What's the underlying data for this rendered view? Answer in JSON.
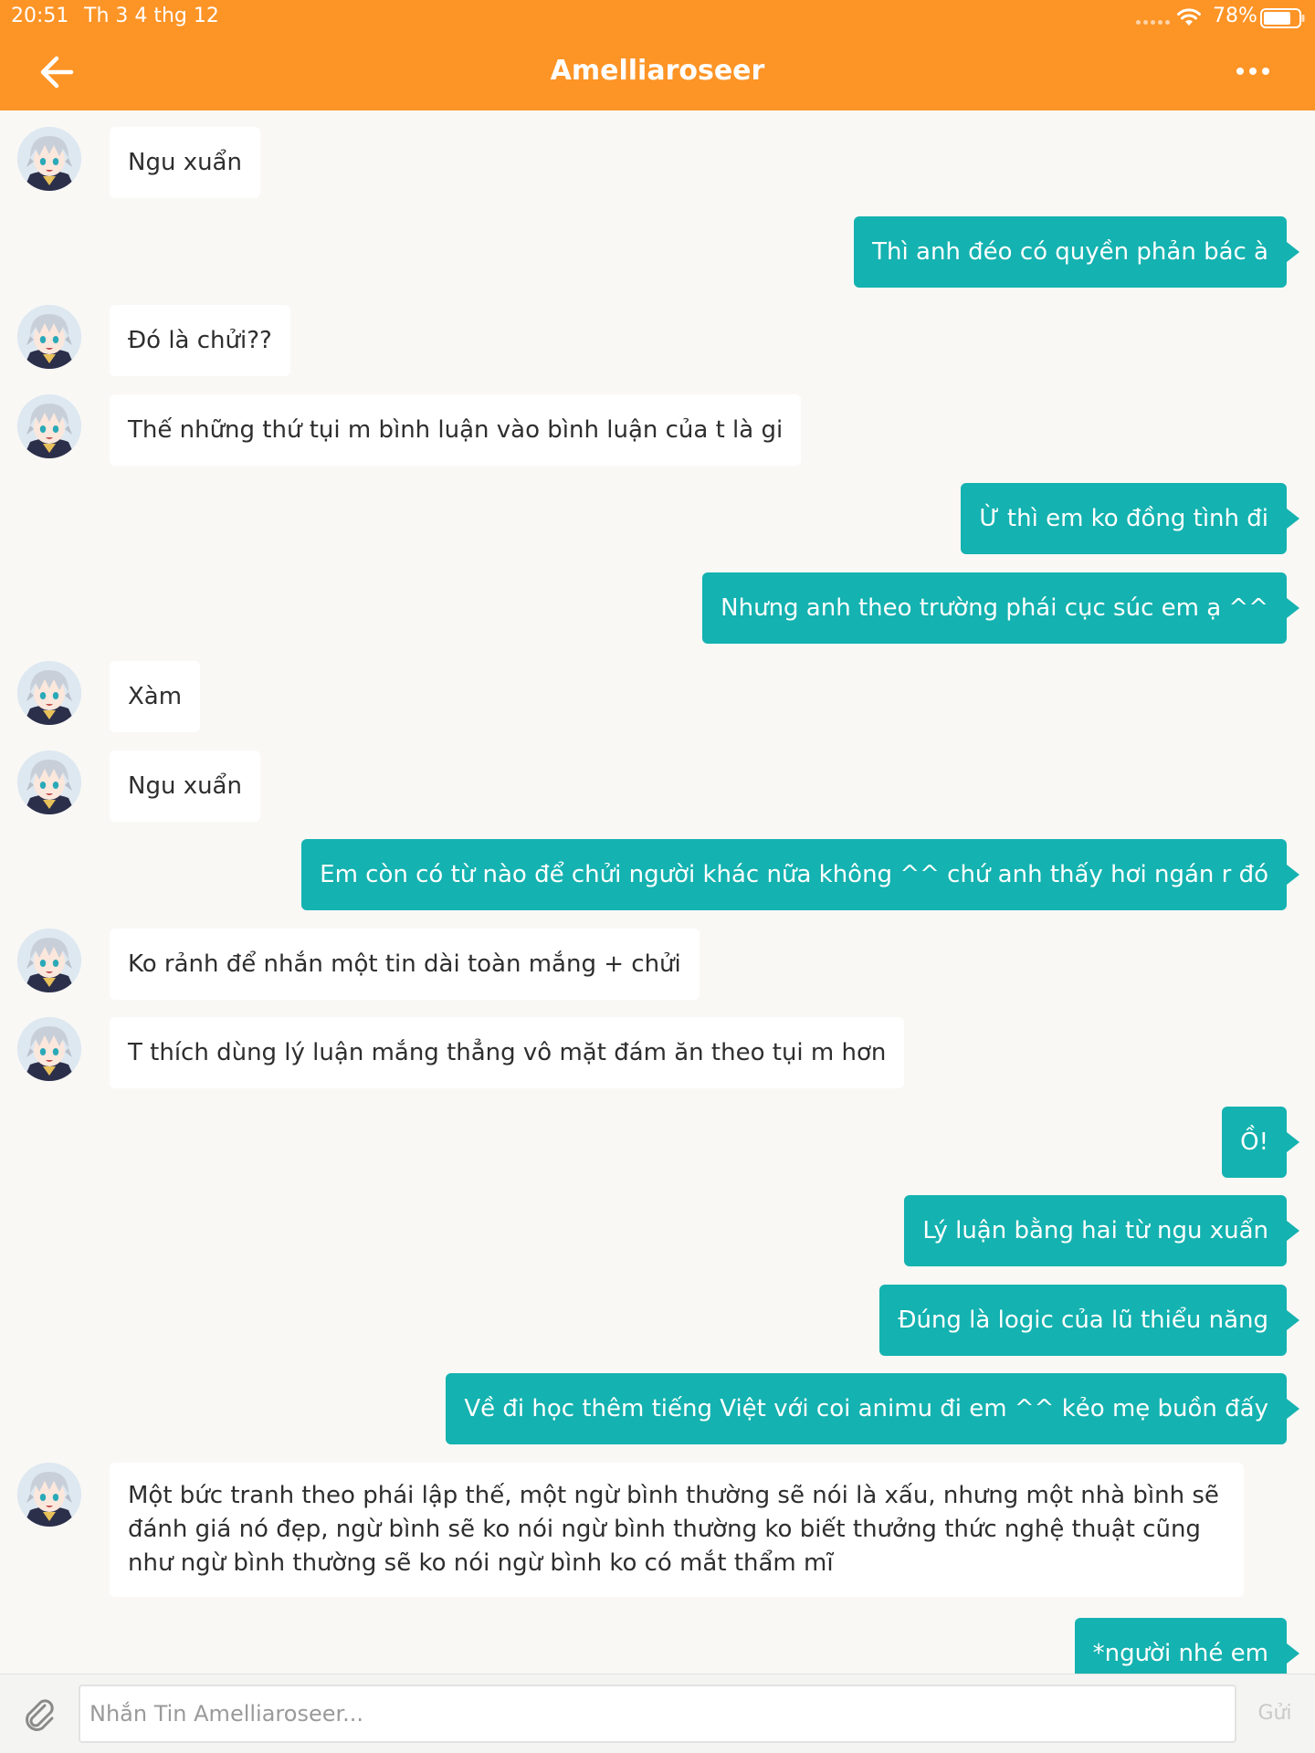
{
  "status_bar": {
    "time": "20:51",
    "date": "Th 3 4 thg 12",
    "battery": "78%",
    "battery_level": 0.78
  },
  "header": {
    "title": "Amelliaroseer",
    "back_icon": "arrow-left-icon",
    "more_icon": "more-horizontal-icon",
    "background_color": "#fd9426"
  },
  "messages": [
    {
      "direction": "in",
      "text": "Ngu xuẩn"
    },
    {
      "direction": "out",
      "text": "Thì anh đéo có quyền phản bác à"
    },
    {
      "direction": "in",
      "text": "Đó là chửi??"
    },
    {
      "direction": "in",
      "text": "Thế những thứ tụi m bình luận vào bình luận của t là gi"
    },
    {
      "direction": "out",
      "text": "Ừ thì em ko đồng tình đi"
    },
    {
      "direction": "out",
      "text": "Nhưng anh theo trường phái cục súc em ạ ^^"
    },
    {
      "direction": "in",
      "text": "Xàm"
    },
    {
      "direction": "in",
      "text": "Ngu xuẩn"
    },
    {
      "direction": "out",
      "text": "Em còn có từ nào để chửi người khác nữa không ^^ chứ anh thấy hơi ngán r đó"
    },
    {
      "direction": "in",
      "text": "Ko rảnh để nhắn một tin dài toàn mắng + chửi"
    },
    {
      "direction": "in",
      "text": "T thích dùng lý luận mắng thẳng vô mặt đám ăn theo tụi m hơn"
    },
    {
      "direction": "out",
      "text": "Ồ!"
    },
    {
      "direction": "out",
      "text": "Lý luận bằng hai từ ngu xuẩn"
    },
    {
      "direction": "out",
      "text": "Đúng là logic của lũ thiểu năng"
    },
    {
      "direction": "out",
      "text": "Về đi học thêm tiếng Việt với coi animu đi em ^^ kẻo mẹ buồn đấy"
    },
    {
      "direction": "in",
      "text": "Một bức tranh theo phái lập thế, một ngừ bình thường sẽ nói là xấu, nhưng một nhà bình sẽ đánh giá nó đẹp, ngừ bình sẽ ko nói ngừ bình thường ko biết thưởng thức nghệ thuật cũng như ngừ bình thường sẽ ko nói ngừ bình ko có mắt thẩm mĩ"
    },
    {
      "direction": "out",
      "text": "*người nhé em"
    }
  ],
  "input_bar": {
    "placeholder": "Nhắn Tin Amelliaroseer...",
    "value": "",
    "send_label": "Gửi",
    "attach_icon": "paperclip-icon"
  },
  "colors": {
    "outgoing_bubble": "#14b2b0",
    "incoming_bubble": "#ffffff",
    "chat_background": "#f9f8f5"
  }
}
